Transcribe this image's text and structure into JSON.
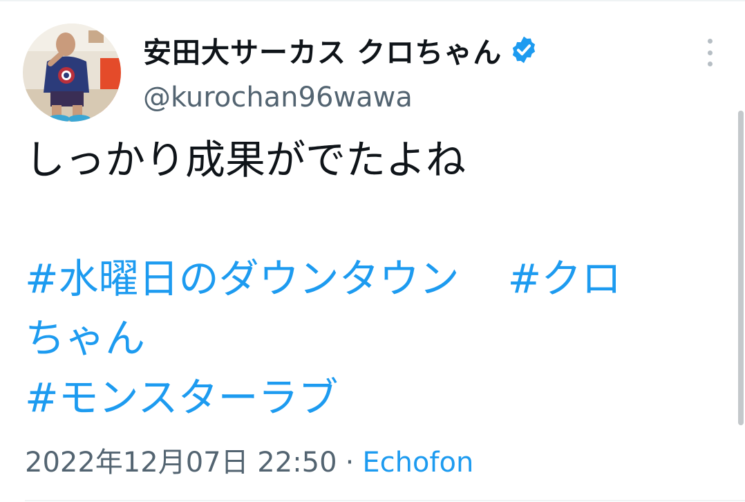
{
  "tweet": {
    "display_name": "安田大サーカス クロちゃん",
    "verified_icon": "verified-badge-icon",
    "handle": "@kurochan96wawa",
    "more_icon": "more-vertical-icon",
    "text": "しっかり成果がでたよね",
    "hashtags": {
      "line1_a": "#水曜日のダウンタウン",
      "line1_b": "#クロ",
      "line2": "ちゃん",
      "line3": "#モンスターラブ"
    },
    "timestamp": "2022年12月07日 22:50",
    "separator": "·",
    "source": "Echofon"
  },
  "colors": {
    "link": "#1d9bf0",
    "secondary_text": "#536471",
    "primary_text": "#0f1419"
  }
}
